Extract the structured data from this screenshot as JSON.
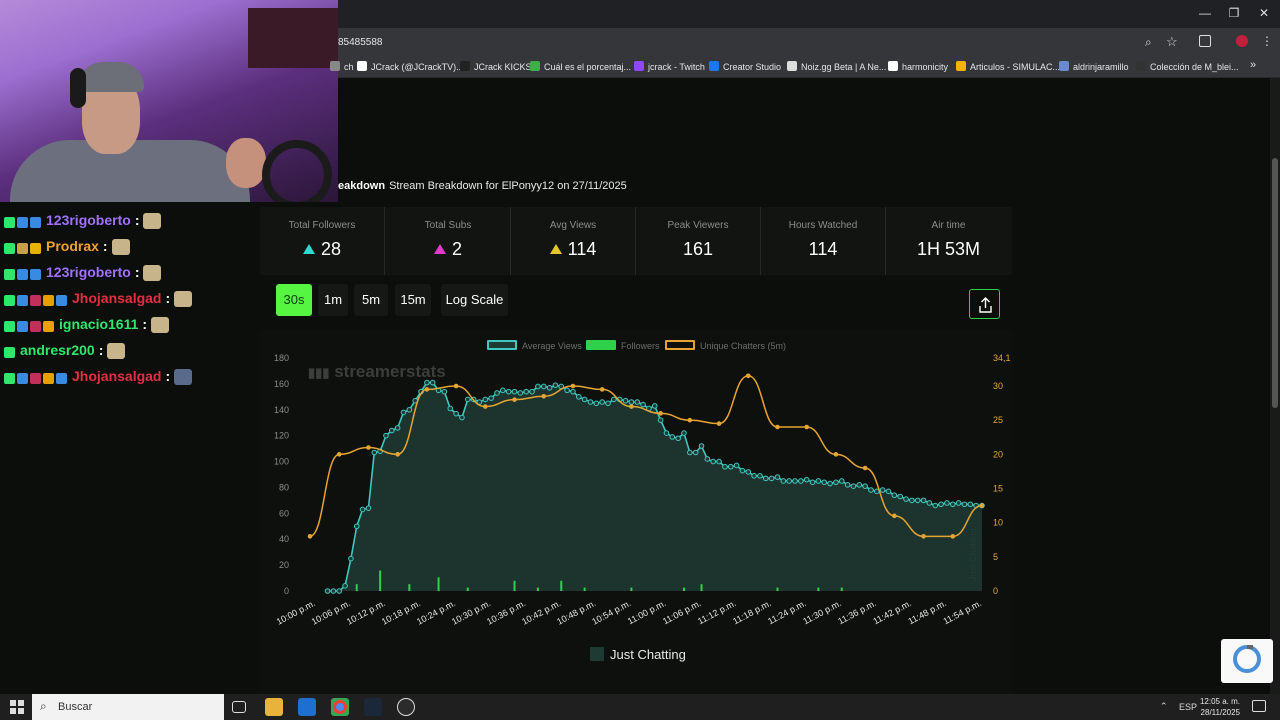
{
  "browser": {
    "url": "85485588",
    "bookmarks": [
      {
        "label": "ch",
        "icon": "globe-icon"
      },
      {
        "label": "JCrack (@JCrackTV)...",
        "icon": "x-icon"
      },
      {
        "label": "JCrack KICKS",
        "icon": "kick-icon"
      },
      {
        "label": "Cuál es el porcentaj...",
        "icon": "doc-icon"
      },
      {
        "label": "jcrack - Twitch",
        "icon": "twitch-icon"
      },
      {
        "label": "Creator Studio",
        "icon": "facebook-icon"
      },
      {
        "label": "Noiz.gg Beta | A Ne...",
        "icon": "noiz-icon"
      },
      {
        "label": "harmonicity",
        "icon": "harmonicity-icon"
      },
      {
        "label": "Articulos - SIMULAC...",
        "icon": "drive-icon"
      },
      {
        "label": "aldrinjaramillo",
        "icon": "site-icon"
      },
      {
        "label": "Colección de M_blei...",
        "icon": "github-icon"
      }
    ],
    "more_bookmarks": "»"
  },
  "chat": [
    {
      "user": "123rigoberto",
      "color": "#a070ff"
    },
    {
      "user": "Prodrax",
      "color": "#f0a030"
    },
    {
      "user": "123rigoberto",
      "color": "#a070ff"
    },
    {
      "user": "Jhojansalgad",
      "color": "#e03040"
    },
    {
      "user": "ignacio1611",
      "color": "#2ee86c"
    },
    {
      "user": "andresr200",
      "color": "#2ee86c"
    },
    {
      "user": "Jhojansalgad",
      "color": "#e03040"
    }
  ],
  "chat_separator": ":",
  "heading": {
    "bold": "eakdown",
    "text": "Stream Breakdown for ElPonyy12 on 27/11/2025"
  },
  "stats": [
    {
      "label": "Total Followers",
      "value": "28",
      "arrow": "#2fd9d0"
    },
    {
      "label": "Total Subs",
      "value": "2",
      "arrow": "#e23ac8"
    },
    {
      "label": "Avg Views",
      "value": "114",
      "arrow": "#e6c42a"
    },
    {
      "label": "Peak Viewers",
      "value": "161"
    },
    {
      "label": "Hours Watched",
      "value": "114"
    },
    {
      "label": "Air time",
      "value": "1H 53M"
    }
  ],
  "intervals": [
    "30s",
    "1m",
    "5m",
    "15m",
    "Log Scale"
  ],
  "active_interval": "30s",
  "colors": {
    "accent": "#55f542",
    "views": "#3ec8c0",
    "followers": "#2fd04a",
    "chatters": "#e6a532",
    "area": "#1e3b33"
  },
  "watermark": "streamerstats",
  "category": "Just Chatting",
  "chart_data": {
    "type": "line",
    "legend": [
      "Average Views",
      "Followers",
      "Unique Chatters (5m)"
    ],
    "x_ticks": [
      "10:00 p.m.",
      "10:06 p.m.",
      "10:12 p.m.",
      "10:18 p.m.",
      "10:24 p.m.",
      "10:30 p.m.",
      "10:36 p.m.",
      "10:42 p.m.",
      "10:48 p.m.",
      "10:54 p.m.",
      "11:00 p.m.",
      "11:06 p.m.",
      "11:12 p.m.",
      "11:18 p.m.",
      "11:24 p.m.",
      "11:30 p.m.",
      "11:36 p.m.",
      "11:42 p.m.",
      "11:48 p.m.",
      "11:54 p.m."
    ],
    "y_left_ticks": [
      0,
      20,
      40,
      60,
      80,
      100,
      120,
      140,
      160,
      180
    ],
    "y_right_ticks": [
      "0",
      "5",
      "10",
      "15",
      "20",
      "25",
      "30",
      "34,1"
    ],
    "y_left_range": [
      0,
      180
    ],
    "y_right_range": [
      0,
      34.1
    ],
    "y_right_label": "Just Chatting",
    "x_range_minutes": [
      0,
      115
    ],
    "series": [
      {
        "name": "Average Views",
        "x": [
          3,
          4,
          5,
          6,
          7,
          8,
          9,
          10,
          11,
          12,
          13,
          14,
          15,
          16,
          17,
          18,
          19,
          20,
          21,
          22,
          23,
          24,
          25,
          26,
          27,
          28,
          29,
          30,
          31,
          32,
          33,
          34,
          35,
          36,
          37,
          38,
          39,
          40,
          41,
          42,
          43,
          44,
          45,
          46,
          47,
          48,
          49,
          50,
          51,
          52,
          53,
          54,
          55,
          56,
          57,
          58,
          59,
          60,
          61,
          62,
          63,
          64,
          65,
          66,
          67,
          68,
          69,
          70,
          71,
          72,
          73,
          74,
          75,
          76,
          77,
          78,
          79,
          80,
          81,
          82,
          83,
          84,
          85,
          86,
          87,
          88,
          89,
          90,
          91,
          92,
          93,
          94,
          95,
          96,
          97,
          98,
          99,
          100,
          101,
          102,
          103,
          104,
          105,
          106,
          107,
          108,
          109,
          110,
          111,
          112,
          113,
          114,
          115
        ],
        "values": [
          0,
          0,
          0,
          4,
          25,
          50,
          63,
          64,
          107,
          108,
          120,
          124,
          126,
          138,
          140,
          147,
          154,
          161,
          161,
          155,
          154,
          141,
          137,
          134,
          148,
          148,
          146,
          148,
          149,
          153,
          155,
          154,
          154,
          153,
          154,
          154,
          158,
          158,
          157,
          159,
          158,
          155,
          154,
          150,
          148,
          146,
          145,
          146,
          145,
          148,
          148,
          147,
          146,
          146,
          144,
          141,
          143,
          132,
          122,
          119,
          118,
          122,
          107,
          107,
          112,
          102,
          100,
          100,
          96,
          96,
          97,
          93,
          92,
          89,
          89,
          87,
          87,
          88,
          85,
          85,
          85,
          85,
          86,
          84,
          85,
          84,
          83,
          84,
          85,
          82,
          81,
          82,
          81,
          78,
          77,
          78,
          77,
          74,
          73,
          71,
          70,
          70,
          70,
          68,
          66,
          67,
          68,
          67,
          68,
          67,
          67,
          66,
          66
        ]
      },
      {
        "name": "Unique Chatters (5m)",
        "x": [
          0,
          5,
          10,
          15,
          20,
          25,
          30,
          35,
          40,
          45,
          50,
          55,
          60,
          65,
          70,
          75,
          80,
          85,
          90,
          95,
          100,
          105,
          110,
          115
        ],
        "values": [
          8,
          20,
          21,
          20,
          29.5,
          30,
          27,
          28,
          28.5,
          30,
          29.5,
          27,
          26,
          25,
          24.5,
          31.5,
          24,
          24,
          20,
          18,
          11,
          8,
          8,
          12.5
        ]
      },
      {
        "name": "Followers",
        "x": [
          8,
          12,
          17,
          22,
          27,
          35,
          39,
          43,
          47,
          55,
          64,
          67,
          80,
          87,
          91
        ],
        "values": [
          1,
          3,
          1,
          2,
          0.5,
          1.5,
          0.5,
          1.5,
          0.5,
          0.5,
          0.5,
          1,
          0.5,
          0.5,
          0.5
        ]
      }
    ]
  },
  "taskbar": {
    "search_placeholder": "Buscar",
    "lang": "ESP",
    "time": "12:05 a. m.",
    "date": "28/11/2025"
  }
}
